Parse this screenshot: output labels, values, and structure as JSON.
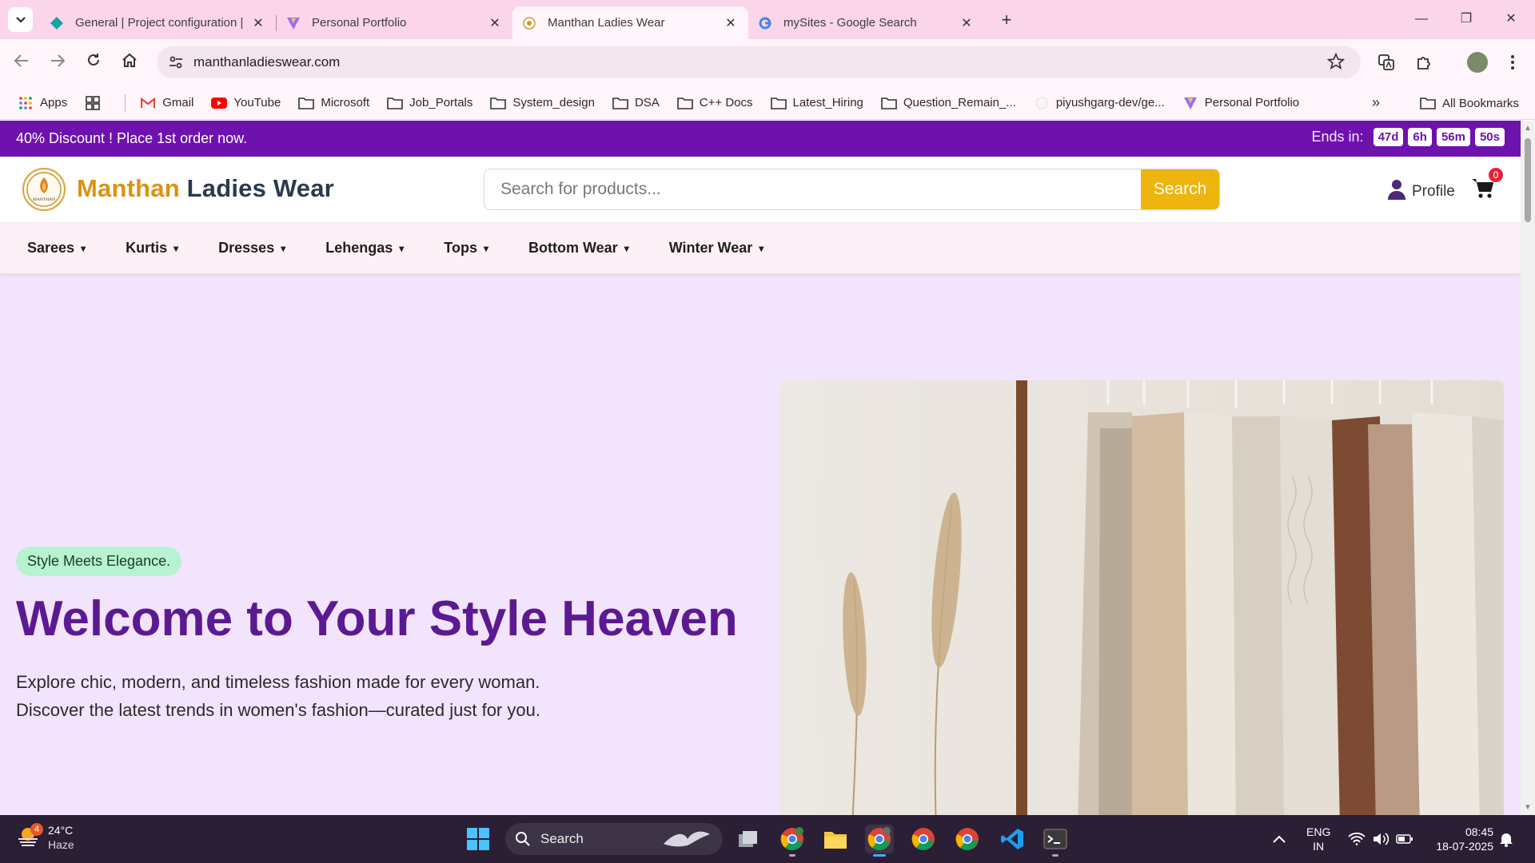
{
  "browser": {
    "tabs": [
      {
        "title": "General | Project configuration |",
        "active": false
      },
      {
        "title": "Personal Portfolio",
        "active": false
      },
      {
        "title": "Manthan Ladies Wear",
        "active": true
      },
      {
        "title": "mySites - Google Search",
        "active": false
      }
    ],
    "url": "manthanladieswear.com",
    "bookmarks": [
      {
        "label": "Apps",
        "icon": "apps-grid-icon"
      },
      {
        "label": "Gmail",
        "icon": "gmail-icon"
      },
      {
        "label": "YouTube",
        "icon": "youtube-icon"
      },
      {
        "label": "Microsoft",
        "icon": "folder-icon"
      },
      {
        "label": "Job_Portals",
        "icon": "folder-icon"
      },
      {
        "label": "System_design",
        "icon": "folder-icon"
      },
      {
        "label": "DSA",
        "icon": "folder-icon"
      },
      {
        "label": "C++ Docs",
        "icon": "folder-icon"
      },
      {
        "label": "Latest_Hiring",
        "icon": "folder-icon"
      },
      {
        "label": "Question_Remain_...",
        "icon": "folder-icon"
      },
      {
        "label": "piyushgarg-dev/ge...",
        "icon": "github-icon"
      },
      {
        "label": "Personal Portfolio",
        "icon": "vite-icon"
      }
    ],
    "all_bookmarks": "All Bookmarks"
  },
  "promo": {
    "text": "40% Discount ! Place 1st order now.",
    "ends_label": "Ends in:",
    "days": "47d",
    "hours": "6h",
    "minutes": "56m",
    "seconds": "50s"
  },
  "header": {
    "brand_first": "Manthan",
    "brand_rest": " Ladies Wear",
    "logo_text": "MANTHAN",
    "search_placeholder": "Search for products...",
    "search_button": "Search",
    "profile_label": "Profile",
    "cart_count": "0"
  },
  "categories": [
    "Sarees",
    "Kurtis",
    "Dresses",
    "Lehengas",
    "Tops",
    "Bottom Wear",
    "Winter Wear"
  ],
  "hero": {
    "tagline": "Style Meets Elegance.",
    "heading": "Welcome to Your Style Heaven",
    "sub1": "Explore chic, modern, and timeless fashion made for every woman.",
    "sub2": "Discover the latest trends in women's fashion—curated just for you."
  },
  "taskbar": {
    "weather_badge": "4",
    "temperature": "24°C",
    "condition": "Haze",
    "search": "Search",
    "lang1": "ENG",
    "lang2": "IN",
    "time": "08:45",
    "date": "18-07-2025"
  },
  "colors": {
    "promo": "#6e12ae",
    "brand_gold": "#d89412",
    "search_button": "#edb50e",
    "hero_bg": "#f3e4fd",
    "heading": "#5b1a91"
  }
}
